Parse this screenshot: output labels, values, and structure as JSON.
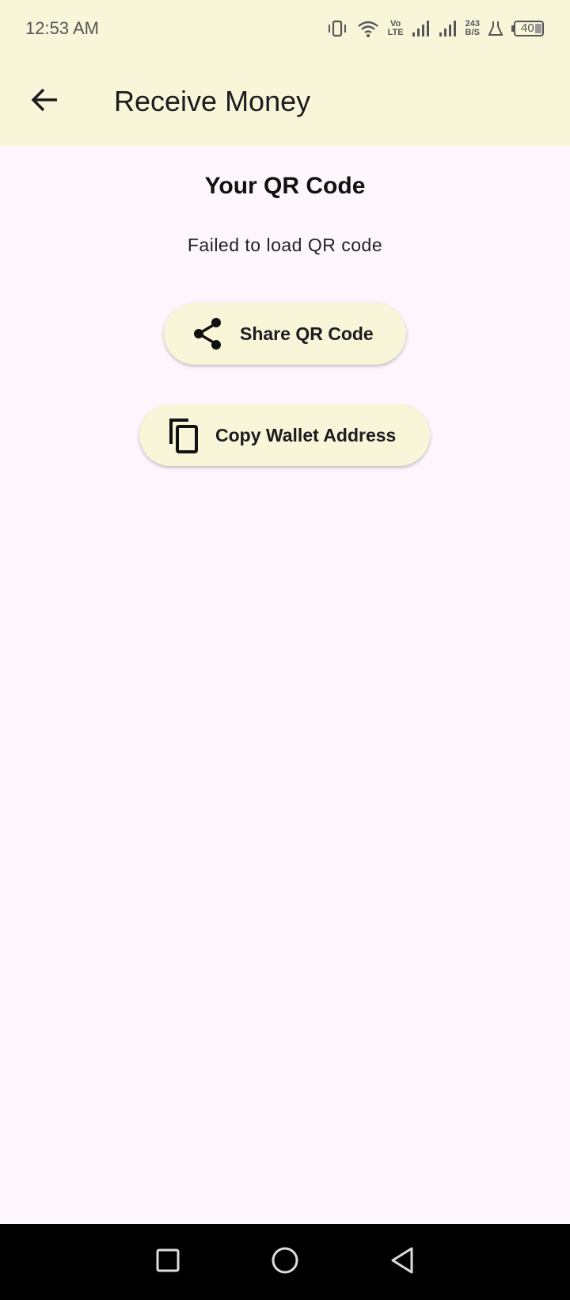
{
  "status_bar": {
    "time": "12:53 AM",
    "network_label_top": "Vo",
    "network_label_bottom": "LTE",
    "speed_value": "243",
    "speed_unit": "B/S",
    "battery": "40"
  },
  "app_bar": {
    "title": "Receive Money",
    "back_icon": "arrow-back-icon"
  },
  "main": {
    "heading": "Your QR Code",
    "error_message": "Failed to load QR code",
    "share_button": {
      "label": "Share QR Code",
      "icon": "share-icon"
    },
    "copy_button": {
      "label": "Copy Wallet Address",
      "icon": "copy-icon"
    }
  },
  "nav_bar": {
    "recents_icon": "square-icon",
    "home_icon": "circle-icon",
    "back_icon": "triangle-back-icon"
  },
  "colors": {
    "app_bar_bg": "#f8f5d9",
    "page_bg": "#fdf7fd",
    "button_bg": "#f8f5d9",
    "nav_bar_bg": "#000000"
  }
}
